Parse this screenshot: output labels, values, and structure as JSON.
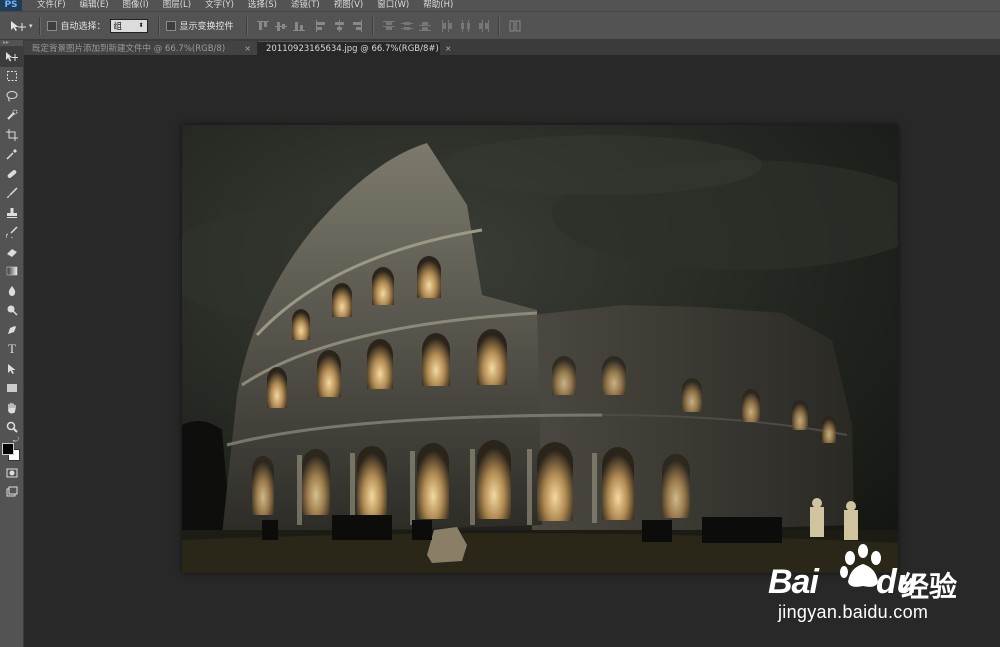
{
  "app": {
    "logo": "PS",
    "menu": [
      "文件(F)",
      "编辑(E)",
      "图像(I)",
      "图层(L)",
      "文字(Y)",
      "选择(S)",
      "滤镜(T)",
      "视图(V)",
      "窗口(W)",
      "帮助(H)"
    ]
  },
  "options_bar": {
    "tool_icon": "move-tool-icon",
    "auto_select_label": "自动选择：",
    "auto_select_checked": false,
    "auto_select_value": "组",
    "show_transform_label": "显示变换控件",
    "show_transform_checked": false,
    "align_buttons": [
      "align-top-edges",
      "align-vertical-centers",
      "align-bottom-edges",
      "align-left-edges",
      "align-horizontal-centers",
      "align-right-edges",
      "distribute-top",
      "distribute-vertical-centers",
      "distribute-bottom",
      "distribute-left",
      "distribute-horizontal-centers",
      "distribute-right",
      "auto-align-layers"
    ]
  },
  "tabs": [
    {
      "label": "既定背景图片添加到新建文件中 @ 66.7%(RGB/8)",
      "active": false,
      "close": "×"
    },
    {
      "label": "20110923165634.jpg @ 66.7%(RGB/8#)",
      "active": true,
      "close": "×"
    }
  ],
  "toolbox": {
    "tools": [
      "move-tool",
      "marquee-tool",
      "lasso-tool",
      "quick-selection-tool",
      "crop-tool",
      "eyedropper-tool",
      "spot-healing-tool",
      "brush-tool",
      "clone-stamp-tool",
      "history-brush-tool",
      "eraser-tool",
      "gradient-tool",
      "blur-tool",
      "dodge-tool",
      "pen-tool",
      "type-tool",
      "path-selection-tool",
      "rectangle-tool",
      "hand-tool",
      "zoom-tool"
    ],
    "type_tool_glyph": "T",
    "foreground_color": "#000000",
    "background_color": "#ffffff"
  },
  "document": {
    "image_subject": "Colosseum at night under a dark cloudy sky"
  },
  "watermark": {
    "brand_left": "Bai",
    "brand_right": "du",
    "brand_cn": "经验",
    "url": "jingyan.baidu.com"
  },
  "colors": {
    "panel": "#535353",
    "workspace": "#282828",
    "tab_inactive": "#424242"
  }
}
